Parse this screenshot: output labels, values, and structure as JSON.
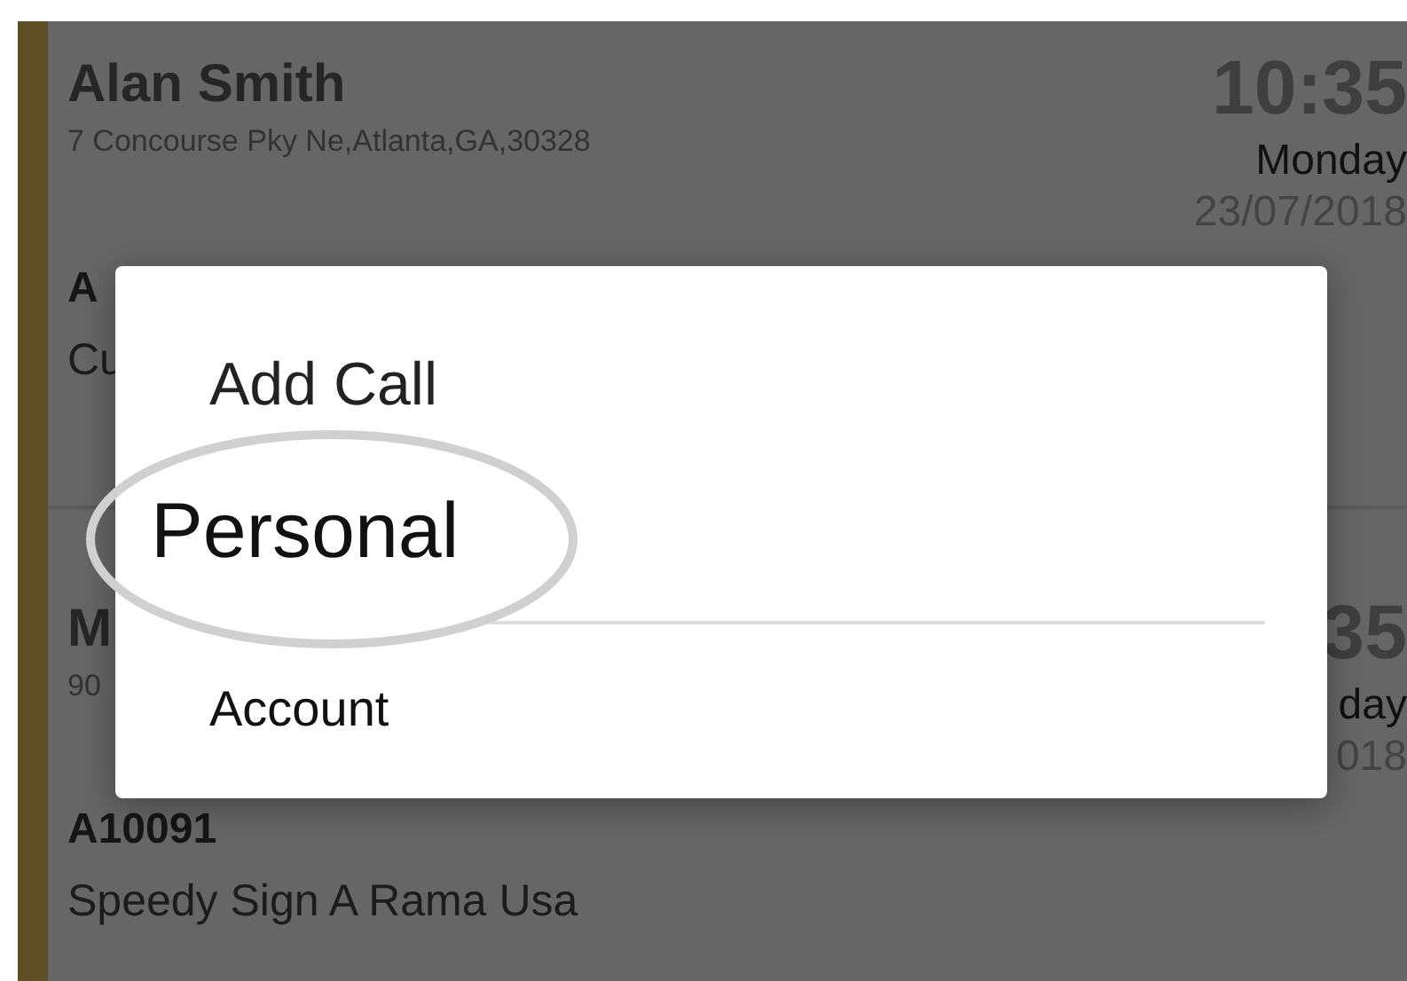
{
  "calls": [
    {
      "name": "Alan Smith",
      "address": "7 Concourse Pky Ne,Atlanta,GA,30328",
      "time": "10:35",
      "day": "Monday",
      "date": "23/07/2018",
      "account": "A",
      "company": "Cu"
    },
    {
      "name": "M",
      "address": "90",
      "time": "35",
      "day": "day",
      "date": "018",
      "account": "A10091",
      "company": "Speedy Sign A Rama Usa"
    }
  ],
  "dialog": {
    "title": "Add Call",
    "options": [
      {
        "label": "Personal",
        "highlighted": true
      },
      {
        "label": "Account",
        "highlighted": false
      }
    ]
  }
}
